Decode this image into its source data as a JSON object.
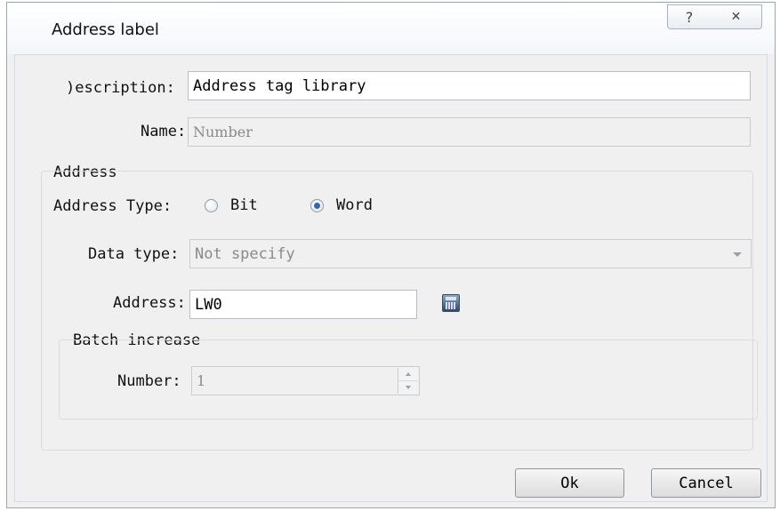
{
  "window": {
    "title": "Address label",
    "help_icon": "help-icon",
    "help_glyph": "?",
    "close_icon": "close-icon",
    "close_glyph": "✕"
  },
  "description": {
    "label": ")escription:",
    "value": "Address tag library"
  },
  "name": {
    "label": "Name:",
    "value": "Number"
  },
  "address_group": {
    "title": "Address",
    "address_type_label": "Address Type:",
    "options": [
      {
        "label": "Bit",
        "checked": false
      },
      {
        "label": "Word",
        "checked": true
      }
    ],
    "data_type": {
      "label": "Data type:",
      "value": "Not specify"
    },
    "address": {
      "label": "Address:",
      "value": "LW0",
      "button_icon": "calculator-icon"
    }
  },
  "batch_group": {
    "title": "Batch increase",
    "number": {
      "label": "Number:",
      "value": "1"
    }
  },
  "buttons": {
    "ok": "Ok",
    "cancel": "Cancel"
  }
}
